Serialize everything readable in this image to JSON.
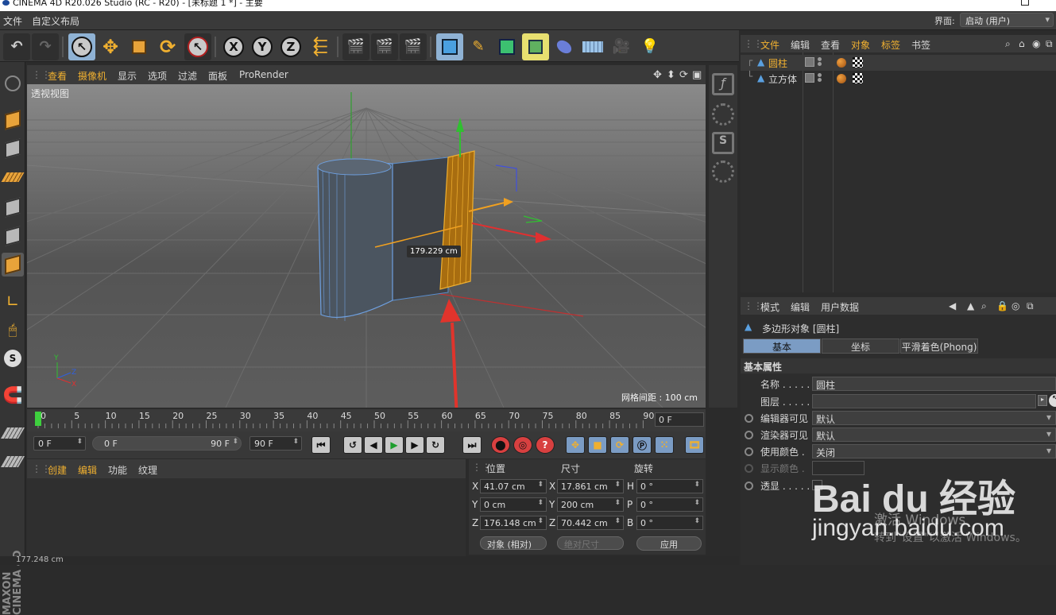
{
  "window": {
    "title": "CINEMA 4D R20.026 Studio (RC - R20) - [未标题 1 *] - 主要"
  },
  "menubar": {
    "items": [
      "文件",
      "自定义布局"
    ],
    "layout_label": "界面:",
    "layout_value": "启动 (用户)"
  },
  "viewport": {
    "menu": [
      "查看",
      "摄像机",
      "显示",
      "选项",
      "过滤",
      "面板",
      "ProRender"
    ],
    "label": "透视视图",
    "grid_spacing": "网格间距 : 100 cm",
    "measure": "179.229 cm"
  },
  "timeline": {
    "ticks": [
      "0",
      "5",
      "10",
      "15",
      "20",
      "25",
      "30",
      "35",
      "40",
      "45",
      "50",
      "55",
      "60",
      "65",
      "70",
      "75",
      "80",
      "85",
      "90"
    ],
    "current_frame": "0 F"
  },
  "playback": {
    "start": "0 F",
    "range_start": "0 F",
    "range_end": "90 F",
    "end": "90 F"
  },
  "material_manager": {
    "tabs": [
      "创建",
      "编辑",
      "功能",
      "纹理"
    ]
  },
  "coordinates": {
    "headers": [
      "位置",
      "尺寸",
      "旋转"
    ],
    "rows": [
      {
        "pos_axis": "X",
        "pos": "41.07 cm",
        "size_axis": "X",
        "size": "17.861 cm",
        "rot_axis": "H",
        "rot": "0 °"
      },
      {
        "pos_axis": "Y",
        "pos": "0 cm",
        "size_axis": "Y",
        "size": "200 cm",
        "rot_axis": "P",
        "rot": "0 °"
      },
      {
        "pos_axis": "Z",
        "pos": "176.148 cm",
        "size_axis": "Z",
        "size": "70.442 cm",
        "rot_axis": "B",
        "rot": "0 °"
      }
    ],
    "mode": "对象 (相对)",
    "size_mode": "绝对尺寸",
    "apply": "应用"
  },
  "object_manager": {
    "menu": [
      "文件",
      "编辑",
      "查看",
      "对象",
      "标签",
      "书签"
    ],
    "objects": [
      {
        "name": "圆柱"
      },
      {
        "name": "立方体"
      }
    ]
  },
  "attribute_manager": {
    "menu": [
      "模式",
      "编辑",
      "用户数据"
    ],
    "object_title": "多边形对象 [圆柱]",
    "tabs": [
      "基本",
      "坐标",
      "平滑着色(Phong)"
    ],
    "section": "基本属性",
    "rows": [
      {
        "label": "名称 . . . . .",
        "value": "圆柱"
      },
      {
        "label": "图层 . . . . .",
        "value": ""
      },
      {
        "label": "编辑器可见",
        "value": "默认"
      },
      {
        "label": "渲染器可见",
        "value": "默认"
      },
      {
        "label": "使用颜色 .",
        "value": "关闭"
      },
      {
        "label": "显示颜色 .",
        "value": ""
      },
      {
        "label": "透显 . . . . .",
        "value": ""
      }
    ]
  },
  "status": {
    "text": "177.248 cm"
  },
  "branding": {
    "maxon": "MAXON CINEMA 4D"
  },
  "watermark": {
    "logo": "Bai du 经验",
    "url": "jingyan.baidu.com",
    "activate_line1": "激活 Windows",
    "activate_line2": "转到\"设置\"以激活 Windows。"
  },
  "colors": {
    "accent": "#f0b030",
    "selected_tab": "#7b9cc4",
    "x_axis": "#e03030",
    "y_axis": "#30c030",
    "z_axis": "#3060e0"
  }
}
